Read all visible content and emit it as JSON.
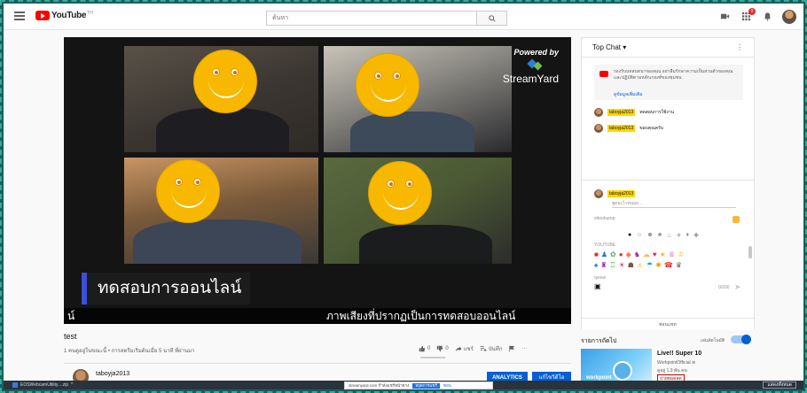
{
  "header": {
    "logo_text": "YouTube",
    "logo_suffix": "TH",
    "search_placeholder": "ค้นหา",
    "notification_count": "9"
  },
  "player": {
    "powered_by": "Powered by",
    "brand": "StreamYard",
    "banner_text": "ทดสอบการออนไลน์",
    "subtitle_left": "น์",
    "subtitle_right": "ภาพเสียงที่ปรากฏเป็นการทดสอบออนไลน์"
  },
  "video": {
    "title": "test",
    "info": "1 คนดูอยู่ในขณะนี้ • การสตรีมเริ่มต้นเมื่อ 5 นาที ที่ผ่านมา",
    "likes": "0",
    "dislikes": "0",
    "share_label": "แชร์",
    "save_label": "บันทึก",
    "more_label": "···",
    "channel_name": "taboyja2013",
    "analytics_label": "ANALYTICS",
    "edit_label": "แก้ไขวิดีโอ"
  },
  "chat": {
    "title": "Top Chat ▾",
    "kebab": "⋮",
    "notice_text": "รองรับบทสนทนาของคุณ อย่าลืมรักษาความเป็นส่วนตัวของคุณและปฏิบัติตามหลักเกณฑ์ของชุมชน",
    "notice_link": "ดูข้อมูลเพิ่มเติม",
    "messages": [
      {
        "author": "taboyja2013",
        "text": "ทดสอบการใช้งาน"
      },
      {
        "author": "taboyja2013",
        "text": "ขอบคุณครับ"
      }
    ],
    "input_author": "taboyja2013",
    "input_sub": "พูดอะไรหน่อย...",
    "input_placeholder": "sttoobump:",
    "emoji_section_youtube": "YOUTUBE",
    "emoji_section_people": "บุคคล",
    "counter": "0/200",
    "send_icon": "send-icon",
    "footer": "ซ่อนแชท"
  },
  "upnext": {
    "label": "รายการถัดไป",
    "autoplay_label": "เล่นอัตโนมัติ",
    "autoplay_on": true,
    "rec_title": "Live!! Super 10",
    "rec_channel": "WorkpointOfficial ⊛",
    "rec_views": "ดูอยู่ 1.3 พัน คน",
    "rec_badge": "ถ่ายทอดสด",
    "thumb_text": "workpoint"
  },
  "bottom": {
    "download_item": "EOSWebcamUtility....zip",
    "download_chevron": "^",
    "share_text": "streamyard.com กำลังแชร์หน้าต่าง",
    "stop_label": "หยุดการแชร์",
    "hide_label": "ซ่อน",
    "show_all": "แสดงทั้งหมด"
  }
}
